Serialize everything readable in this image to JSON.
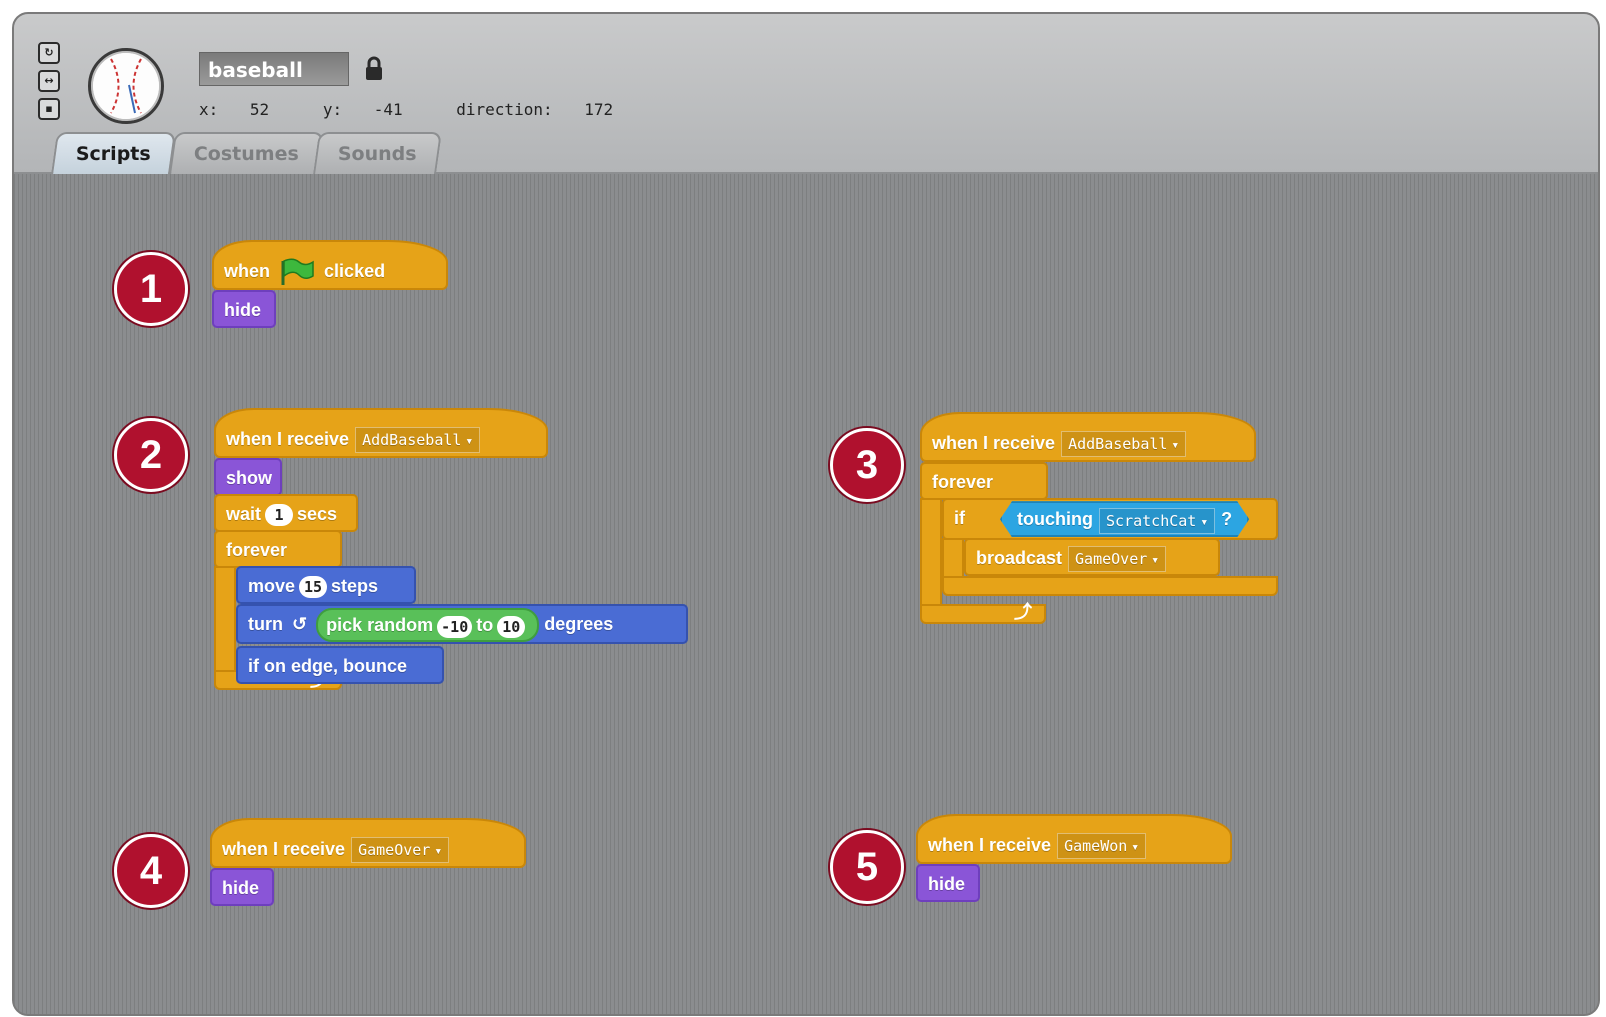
{
  "sprite": {
    "name": "baseball",
    "x_label": "x:",
    "x": "52",
    "y_label": "y:",
    "y": "-41",
    "direction_label": "direction:",
    "direction": "172"
  },
  "tabs": [
    {
      "label": "Scripts"
    },
    {
      "label": "Costumes"
    },
    {
      "label": "Sounds"
    }
  ],
  "badges": [
    "1",
    "2",
    "3",
    "4",
    "5"
  ],
  "script1": {
    "hat_when": "when",
    "hat_clicked": "clicked",
    "b1": "hide"
  },
  "script2": {
    "hat": "when I receive",
    "hat_msg": "AddBaseball",
    "show": "show",
    "wait": "wait",
    "wait_val": "1",
    "secs": "secs",
    "forever": "forever",
    "move": "move",
    "move_val": "15",
    "steps": "steps",
    "turn": "turn",
    "pick_random": "pick random",
    "rand_from": "-10",
    "rand_to_label": "to",
    "rand_to": "10",
    "degrees": "degrees",
    "bounce": "if on edge, bounce"
  },
  "script3": {
    "hat": "when I receive",
    "hat_msg": "AddBaseball",
    "forever": "forever",
    "if": "if",
    "touching": "touching",
    "touching_target": "ScratchCat",
    "question": "?",
    "broadcast": "broadcast",
    "broadcast_msg": "GameOver"
  },
  "script4": {
    "hat": "when I receive",
    "hat_msg": "GameOver",
    "b1": "hide"
  },
  "script5": {
    "hat": "when I receive",
    "hat_msg": "GameWon",
    "b1": "hide"
  },
  "colors": {
    "control": "#e6a318",
    "looks": "#8a55d7",
    "motion": "#4a6cd4",
    "operators": "#59c059",
    "sensing": "#2ca5e2",
    "badge": "#b0112e"
  }
}
